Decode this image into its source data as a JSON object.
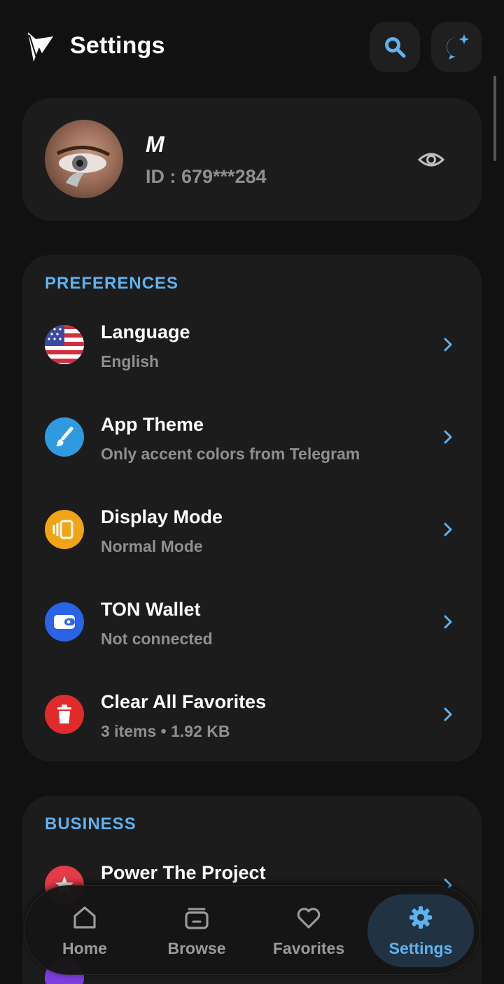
{
  "header": {
    "title": "Settings",
    "search_icon": "search-icon",
    "support_icon": "support-chat-icon"
  },
  "profile": {
    "name": "M",
    "id_text": "ID : 679***284",
    "visibility_icon": "eye-icon"
  },
  "preferences": {
    "section_title": "PREFERENCES",
    "items": [
      {
        "title": "Language",
        "subtitle": "English",
        "icon": "us-flag-icon"
      },
      {
        "title": "App Theme",
        "subtitle": "Only accent colors from Telegram",
        "icon": "paintbrush-icon",
        "color": "#2f9ae0"
      },
      {
        "title": "Display Mode",
        "subtitle": "Normal Mode",
        "icon": "display-mode-icon",
        "color": "#f0a416"
      },
      {
        "title": "TON Wallet",
        "subtitle": "Not connected",
        "icon": "wallet-icon",
        "color": "#2a63e6"
      },
      {
        "title": "Clear All Favorites",
        "subtitle": "3 items • 1.92 KB",
        "icon": "trash-icon",
        "color": "#e12b2b"
      }
    ]
  },
  "business": {
    "section_title": "BUSINESS",
    "items": [
      {
        "title": "Power The Project",
        "icon": "star-icon",
        "color": "#e33b47"
      }
    ]
  },
  "nav": {
    "items": [
      {
        "label": "Home",
        "icon": "home-icon"
      },
      {
        "label": "Browse",
        "icon": "browse-icon"
      },
      {
        "label": "Favorites",
        "icon": "heart-icon"
      },
      {
        "label": "Settings",
        "icon": "gear-icon",
        "active": true
      }
    ]
  },
  "colors": {
    "background": "#111111",
    "card": "#1c1c1c",
    "accent": "#5fb2ee",
    "muted_text": "#8f8f8f"
  }
}
